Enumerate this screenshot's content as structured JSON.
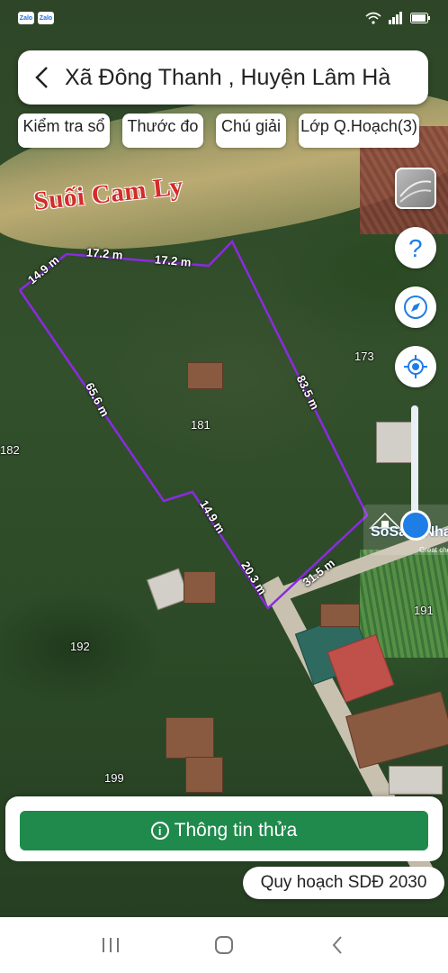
{
  "status_bar": {
    "apps": [
      "Zalo",
      "Zalo"
    ],
    "icons": [
      "wifi-icon",
      "signal-icon",
      "battery-icon"
    ]
  },
  "header": {
    "title": "Xã Đông Thanh , Huyện Lâm Hà",
    "back_icon": "chevron-left-icon"
  },
  "chips": [
    {
      "label": "Kiểm tra sổ"
    },
    {
      "label": "Thước đo"
    },
    {
      "label": "Chú giải"
    },
    {
      "label": "Lớp Q.Hoạch(3)"
    }
  ],
  "map": {
    "river_label": "Suối Cam Ly",
    "parcel_numbers": [
      "181",
      "173",
      "182",
      "191",
      "192",
      "199"
    ],
    "segment_lengths": [
      "14.9 m",
      "17.2 m",
      "17.2 m",
      "65.6 m",
      "83.5 m",
      "14.9 m",
      "20.3 m",
      "31.5 m"
    ],
    "boundary_color": "#8a2be2"
  },
  "controls": {
    "layer": "satellite-layer-icon",
    "help": "help-icon",
    "compass": "compass-icon",
    "locate": "locate-icon",
    "opacity_level": 0.1
  },
  "watermark": {
    "brand": "SoSanhNha",
    "tagline": "Great choice"
  },
  "bottom": {
    "info_button": "Thông tin thửa",
    "plan_pill": "Quy hoạch SDĐ 2030"
  },
  "nav": [
    "recents-icon",
    "home-icon",
    "back-icon"
  ],
  "colors": {
    "accent_green": "#1f8a4c",
    "accent_blue": "#1f7ee6"
  }
}
